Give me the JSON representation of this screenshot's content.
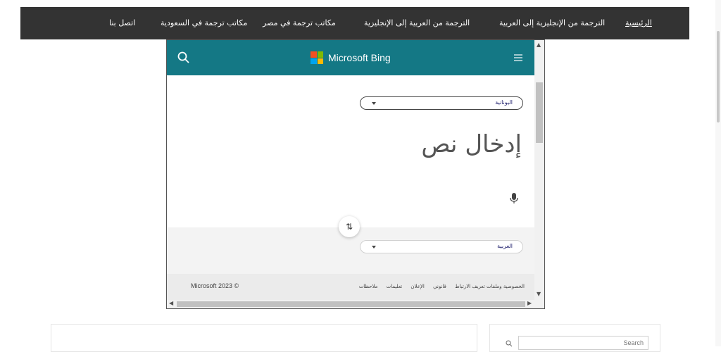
{
  "nav": {
    "items": [
      {
        "label": "الرئيسية",
        "active": true
      },
      {
        "label": "الترجمة من الإنجليزية إلى العربية"
      },
      {
        "label": "الترجمة من العربية إلى الإنجليزية"
      },
      {
        "label": "مكاتب ترجمة في مصر"
      },
      {
        "label": "مكاتب ترجمة في السعودية"
      },
      {
        "label": "اتصل بنا"
      }
    ]
  },
  "translator": {
    "brand": "Microsoft Bing",
    "source_language": "اليونانية",
    "input_placeholder": "إدخال نص",
    "swap_symbol": "⇅",
    "target_language": "العربية",
    "footer": {
      "links": [
        "الخصوصية وملفات تعريف الارتباط",
        "قانوني",
        "الإعلان",
        "تعليمات",
        "ملاحظات"
      ],
      "copyright": "Microsoft 2023 ©"
    }
  },
  "sidebar": {
    "search_placeholder": "Search"
  },
  "colors": {
    "nav_bg": "#333333",
    "bing_header": "#147885",
    "ms_logo": [
      "#f25022",
      "#7fba00",
      "#00a4ef",
      "#ffb900"
    ]
  }
}
